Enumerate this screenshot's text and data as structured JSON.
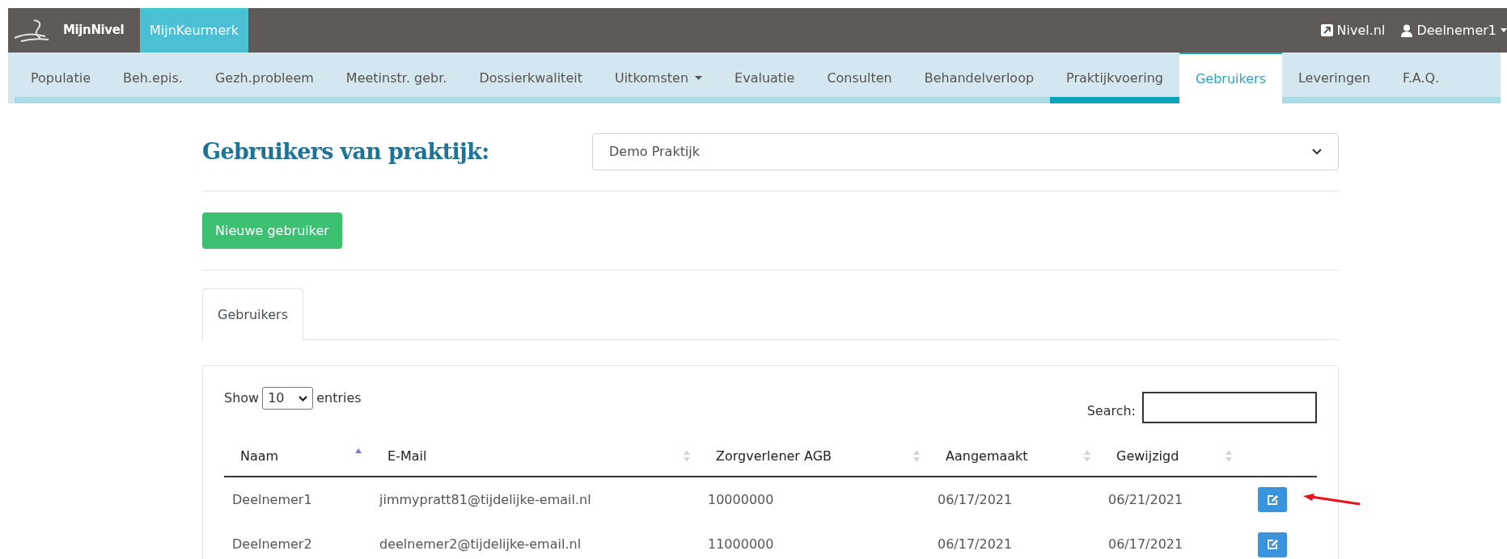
{
  "topbar": {
    "brand": "MijnNivel",
    "apps": [
      {
        "label": "MijnKeurmerk",
        "selected": true
      }
    ],
    "links": [
      {
        "kind": "external",
        "label": "Nivel.nl"
      },
      {
        "kind": "user",
        "label": "Deelnemer1"
      }
    ]
  },
  "nav": [
    {
      "label": "Populatie",
      "selected": false,
      "underline": false,
      "dropdown": false
    },
    {
      "label": "Beh.epis.",
      "selected": false,
      "underline": false,
      "dropdown": false
    },
    {
      "label": "Gezh.probleem",
      "selected": false,
      "underline": false,
      "dropdown": false
    },
    {
      "label": "Meetinstr. gebr.",
      "selected": false,
      "underline": false,
      "dropdown": false
    },
    {
      "label": "Dossierkwaliteit",
      "selected": false,
      "underline": false,
      "dropdown": false
    },
    {
      "label": "Uitkomsten",
      "selected": false,
      "underline": false,
      "dropdown": true
    },
    {
      "label": "Evaluatie",
      "selected": false,
      "underline": false,
      "dropdown": false
    },
    {
      "label": "Consulten",
      "selected": false,
      "underline": false,
      "dropdown": false
    },
    {
      "label": "Behandelverloop",
      "selected": false,
      "underline": false,
      "dropdown": false
    },
    {
      "label": "Praktijkvoering",
      "selected": false,
      "underline": true,
      "dropdown": false
    },
    {
      "label": "Gebruikers",
      "selected": true,
      "underline": false,
      "dropdown": false
    },
    {
      "label": "Leveringen",
      "selected": false,
      "underline": false,
      "dropdown": false
    },
    {
      "label": "F.A.Q.",
      "selected": false,
      "underline": false,
      "dropdown": false
    }
  ],
  "heading": "Gebruikers van praktijk:",
  "practice_select": {
    "value": "Demo Praktijk"
  },
  "new_button": "Nieuwe gebruiker",
  "tabs": [
    {
      "label": "Gebruikers",
      "selected": true
    }
  ],
  "table": {
    "show_label": "Show",
    "entries_value": "10",
    "entries_label": "entries",
    "search_label": "Search:",
    "columns": [
      {
        "label": "Naam",
        "sorted_ascending": true
      },
      {
        "label": "E-Mail",
        "sorted_ascending": false
      },
      {
        "label": "Zorgverlener AGB",
        "sorted_ascending": false
      },
      {
        "label": "Aangemaakt",
        "sorted_ascending": false
      },
      {
        "label": "Gewijzigd",
        "sorted_ascending": false
      }
    ],
    "rows": [
      {
        "cells": [
          "Deelnemer1",
          "jimmypratt81@tijdelijke-email.nl",
          "10000000",
          "06/17/2021",
          "06/21/2021"
        ],
        "annotated": true
      },
      {
        "cells": [
          "Deelnemer2",
          "deelnemer2@tijdelijke-email.nl",
          "11000000",
          "06/17/2021",
          "06/17/2021"
        ],
        "annotated": false
      }
    ]
  }
}
